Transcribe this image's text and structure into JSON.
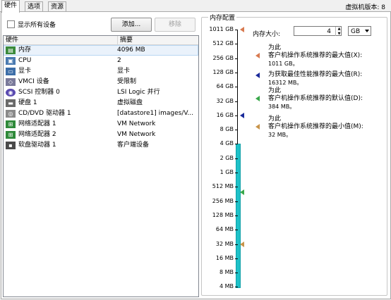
{
  "tabs": [
    {
      "label": "硬件"
    },
    {
      "label": "选项"
    },
    {
      "label": "资源"
    }
  ],
  "version_label": "虚拟机版本: 8",
  "show_all_devices": "显示所有设备",
  "buttons": {
    "add": "添加...",
    "remove": "移除"
  },
  "hardware_list": {
    "headers": [
      "硬件",
      "摘要"
    ],
    "rows": [
      {
        "name": "内存",
        "summary": "4096 MB",
        "icon": "memory-icon",
        "selected": true
      },
      {
        "name": "CPU",
        "summary": "2",
        "icon": "cpu-icon"
      },
      {
        "name": "显卡",
        "summary": "显卡",
        "icon": "video-card-icon"
      },
      {
        "name": "VMCI 设备",
        "summary": "受限制",
        "icon": "vmci-icon"
      },
      {
        "name": "SCSI 控制器 0",
        "summary": "LSI Logic 并行",
        "icon": "scsi-controller-icon"
      },
      {
        "name": "硬盘 1",
        "summary": "虚拟磁盘",
        "icon": "hard-disk-icon"
      },
      {
        "name": "CD/DVD 驱动器 1",
        "summary": "[datastore1] images/V...",
        "icon": "cd-dvd-icon"
      },
      {
        "name": "网络适配器 1",
        "summary": "VM Network",
        "icon": "network-adapter-icon"
      },
      {
        "name": "网络适配器 2",
        "summary": "VM Network",
        "icon": "network-adapter-icon"
      },
      {
        "name": "软盘驱动器 1",
        "summary": "客户端设备",
        "icon": "floppy-icon"
      }
    ]
  },
  "memory_config": {
    "title": "内存配置",
    "size_label": "内存大小:",
    "size_value": "4",
    "unit": "GB",
    "scale_labels": [
      "1011 GB",
      "512 GB",
      "256 GB",
      "128 GB",
      "64 GB",
      "32 GB",
      "16 GB",
      "8 GB",
      "4 GB",
      "2 GB",
      "1 GB",
      "512 MB",
      "256 MB",
      "128 MB",
      "64 MB",
      "32 MB",
      "16 MB",
      "8 MB",
      "4 MB"
    ],
    "legend": [
      {
        "line1": "为此",
        "line2": "客户机操作系统推荐的最大值(X):",
        "value": "1011 GB。",
        "color": "#d87a50"
      },
      {
        "line1": "",
        "line2": "为获取最佳性能推荐的最大值(R):",
        "value": "16312 MB。",
        "color": "#1a2a9a"
      },
      {
        "line1": "为此",
        "line2": "客户机操作系统推荐的默认值(D):",
        "value": "384 MB。",
        "color": "#3aa84a"
      },
      {
        "line1": "为此",
        "line2": "客户机操作系统推荐的最小值(M):",
        "value": "32 MB。",
        "color": "#c8944a"
      }
    ]
  }
}
